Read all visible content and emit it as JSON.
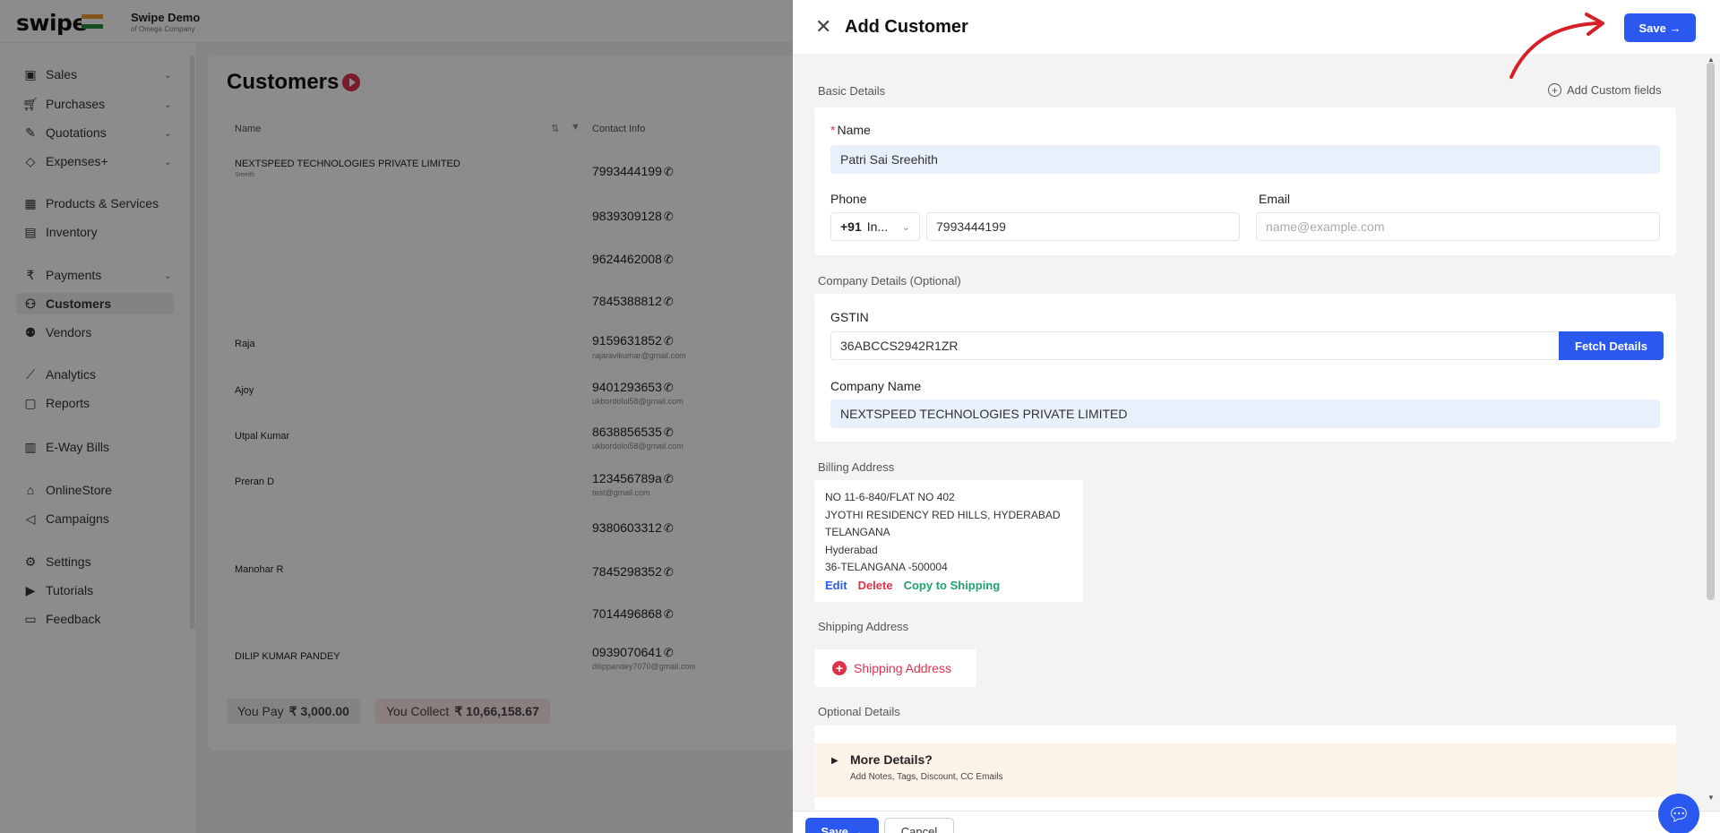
{
  "app": {
    "logo": "swipe",
    "company_name": "Swipe Demo",
    "company_sub": "of Omega Company"
  },
  "sidebar": {
    "items": [
      {
        "label": "Sales",
        "icon": "cash-icon",
        "chevron": true
      },
      {
        "label": "Purchases",
        "icon": "cart-icon",
        "chevron": true
      },
      {
        "label": "Quotations",
        "icon": "pen-icon",
        "chevron": true
      },
      {
        "label": "Expenses+",
        "icon": "tag-icon",
        "chevron": true
      },
      {
        "label": "Products & Services",
        "icon": "box-icon",
        "chevron": false
      },
      {
        "label": "Inventory",
        "icon": "warehouse-icon",
        "chevron": false
      },
      {
        "label": "Payments",
        "icon": "rupee-icon",
        "chevron": true
      },
      {
        "label": "Customers",
        "icon": "user-icon",
        "chevron": false,
        "active": true
      },
      {
        "label": "Vendors",
        "icon": "users-icon",
        "chevron": false
      },
      {
        "label": "Analytics",
        "icon": "chart-icon",
        "chevron": false
      },
      {
        "label": "Reports",
        "icon": "report-icon",
        "chevron": false
      },
      {
        "label": "E-Way Bills",
        "icon": "truck-icon",
        "chevron": false
      },
      {
        "label": "OnlineStore",
        "icon": "store-icon",
        "chevron": false
      },
      {
        "label": "Campaigns",
        "icon": "campaign-icon",
        "chevron": false
      },
      {
        "label": "Settings",
        "icon": "gear-icon",
        "chevron": false
      },
      {
        "label": "Tutorials",
        "icon": "youtube-icon",
        "chevron": false
      },
      {
        "label": "Feedback",
        "icon": "chat-icon",
        "chevron": false
      }
    ]
  },
  "customers": {
    "title": "Customers",
    "columns": {
      "name": "Name",
      "contact": "Contact Info"
    },
    "rows": [
      {
        "name": "NEXTSPEED TECHNOLOGIES PRIVATE LIMITED",
        "sub": "Sreeith",
        "phone": "7993444199",
        "email": ""
      },
      {
        "name": "",
        "sub": "",
        "phone": "9839309128",
        "email": ""
      },
      {
        "name": "",
        "sub": "",
        "phone": "9624462008",
        "email": ""
      },
      {
        "name": "",
        "sub": "",
        "phone": "7845388812",
        "email": ""
      },
      {
        "name": "Raja",
        "sub": "",
        "phone": "9159631852",
        "email": "rajaravikumar@gmail.com"
      },
      {
        "name": "Ajoy",
        "sub": "",
        "phone": "9401293653",
        "email": "ukbordoloi58@gmail.com"
      },
      {
        "name": "Utpal Kumar",
        "sub": "",
        "phone": "8638856535",
        "email": "ukbordoloi58@gmail.com"
      },
      {
        "name": "Preran D",
        "sub": "",
        "phone": "123456789a",
        "email": "test@gmail.com"
      },
      {
        "name": "",
        "sub": "",
        "phone": "9380603312",
        "email": ""
      },
      {
        "name": "Manohar R",
        "sub": "",
        "phone": "7845298352",
        "email": ""
      },
      {
        "name": "",
        "sub": "",
        "phone": "7014496868",
        "email": ""
      },
      {
        "name": "DILIP KUMAR PANDEY",
        "sub": "",
        "phone": "0939070641",
        "email": "dilippandey7070@gmail.com"
      }
    ],
    "you_pay_label": "You Pay",
    "you_pay_value": "₹ 3,000.00",
    "you_collect_label": "You Collect",
    "you_collect_value": "₹ 10,66,158.67"
  },
  "drawer": {
    "title": "Add Customer",
    "save_label": "Save →",
    "cancel_label": "Cancel",
    "basic_details": "Basic Details",
    "add_custom_fields": "Add Custom fields",
    "name_label": "Name",
    "name_value": "Patri Sai Sreehith",
    "phone_label": "Phone",
    "country_code": "+91",
    "country_short": "In...",
    "phone_value": "7993444199",
    "email_label": "Email",
    "email_placeholder": "name@example.com",
    "company_details": "Company Details (Optional)",
    "gstin_label": "GSTIN",
    "gstin_value": "36ABCCS2942R1ZR",
    "fetch_label": "Fetch Details",
    "company_name_label": "Company Name",
    "company_name_value": "NEXTSPEED TECHNOLOGIES PRIVATE LIMITED",
    "billing_address": "Billing Address",
    "billing_lines": [
      "NO 11-6-840/FLAT NO 402",
      "JYOTHI RESIDENCY RED HILLS, HYDERABAD",
      "TELANGANA",
      "Hyderabad",
      "36-TELANGANA -500004"
    ],
    "edit": "Edit",
    "delete": "Delete",
    "copy_to_shipping": "Copy to Shipping",
    "shipping_address": "Shipping Address",
    "shipping_button": "Shipping Address",
    "optional_details": "Optional Details",
    "more_details": "More Details?",
    "more_details_sub": "Add Notes, Tags, Discount, CC Emails"
  }
}
